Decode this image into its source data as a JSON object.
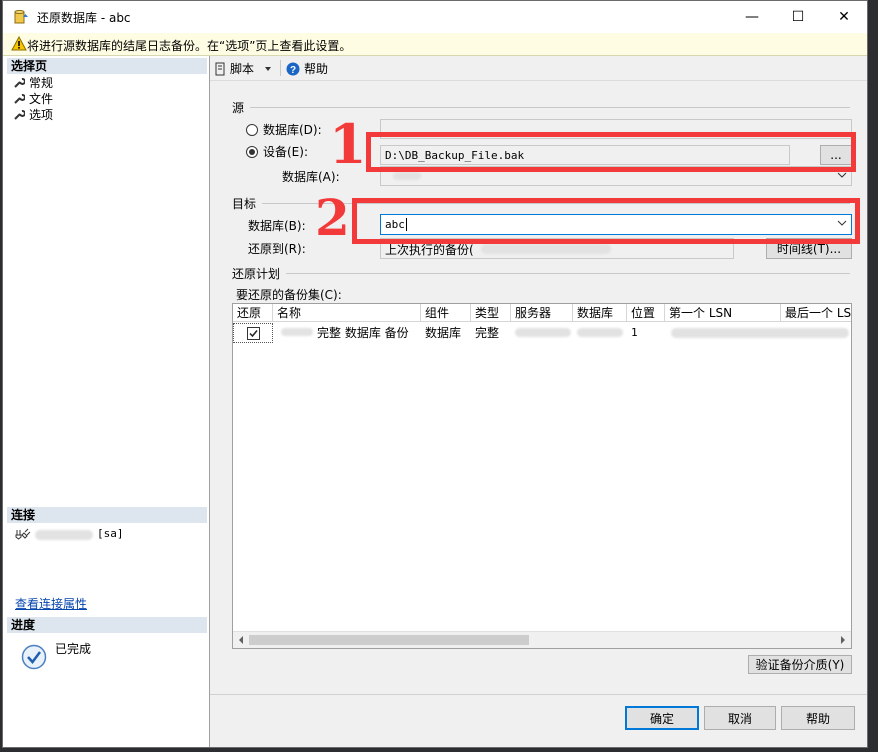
{
  "window": {
    "title": "还原数据库 - abc",
    "minimize": "—",
    "maximize": "☐",
    "close": "✕"
  },
  "warning": {
    "text": "将进行源数据库的结尾日志备份。在“选项”页上查看此设置。"
  },
  "left": {
    "select_page_header": "选择页",
    "pages": [
      {
        "label": "常规"
      },
      {
        "label": "文件"
      },
      {
        "label": "选项"
      }
    ],
    "connection_header": "连接",
    "connection_user": "[sa]",
    "view_connection_link": "查看连接属性",
    "progress_header": "进度",
    "progress_status": "已完成"
  },
  "toolbar": {
    "script_label": "脚本",
    "help_label": "帮助"
  },
  "source": {
    "group_label": "源",
    "database_radio": "数据库(D):",
    "device_radio": "设备(E):",
    "device_path": "D:\\DB_Backup_File.bak",
    "browse_label": "...",
    "database_label": "数据库(A):"
  },
  "target": {
    "group_label": "目标",
    "database_label": "数据库(B):",
    "database_value": "abc",
    "restore_to_label": "还原到(R):",
    "restore_to_value": "上次执行的备份(",
    "timeline_button": "时间线(T)..."
  },
  "plan": {
    "group_label": "还原计划",
    "backupsets_label": "要还原的备份集(C):",
    "columns": [
      "还原",
      "名称",
      "组件",
      "类型",
      "服务器",
      "数据库",
      "位置",
      "第一个 LSN",
      "最后一个 LS"
    ],
    "row": {
      "name": "完整 数据库 备份",
      "component": "数据库",
      "type": "完整",
      "position": "1"
    },
    "verify_button": "验证备份介质(Y)"
  },
  "annotations": {
    "one": "1",
    "two": "2"
  },
  "footer": {
    "ok": "确定",
    "cancel": "取消",
    "help": "帮助"
  }
}
